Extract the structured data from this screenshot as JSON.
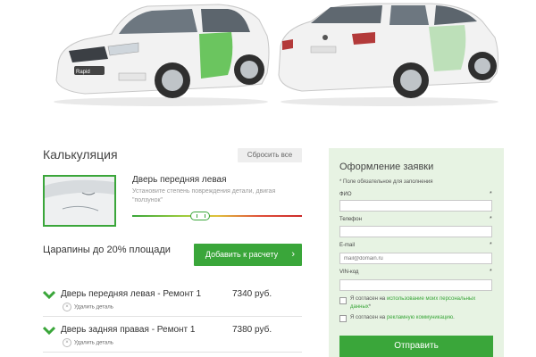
{
  "calculator": {
    "title": "Калькуляция",
    "reset_label": "Сбросить все",
    "selected_part": {
      "name": "Дверь передняя левая",
      "hint": "Установите степень повреждения детали, двигая \"ползунок\""
    },
    "damage_level_fraction": 0.32,
    "damage_label": "Царапины до 20% площади",
    "add_label": "Добавить к расчету",
    "items": [
      {
        "title": "Дверь передняя левая - Ремонт 1",
        "price": "7340 руб.",
        "delete_label": "Удалить деталь"
      },
      {
        "title": "Дверь задняя правая - Ремонт 1",
        "price": "7380 руб.",
        "delete_label": "Удалить деталь"
      }
    ]
  },
  "order_form": {
    "title": "Оформление заявки",
    "required_note": "* Поле обязательное для заполнения",
    "fields": [
      {
        "label": "ФИО",
        "required_mark": "*",
        "placeholder": "",
        "value": ""
      },
      {
        "label": "Телефон",
        "required_mark": "*",
        "placeholder": "",
        "value": ""
      },
      {
        "label": "E-mail",
        "required_mark": "*",
        "placeholder": "mail@domain.ru",
        "value": ""
      },
      {
        "label": "VIN-код",
        "required_mark": "*",
        "placeholder": "",
        "value": ""
      }
    ],
    "consent_1": {
      "prefix": "Я согласен на",
      "link": "использование моих персональных данных",
      "suffix": "*"
    },
    "consent_2": {
      "prefix": "Я согласен на",
      "link": "рекламную коммуникацию",
      "suffix": "."
    },
    "submit_label": "Отправить"
  },
  "car_badge": "Rapid",
  "colors": {
    "accent": "#3aa63a",
    "panel_bg": "#e7f3e3",
    "highlight_panel": "#5cc04f"
  }
}
